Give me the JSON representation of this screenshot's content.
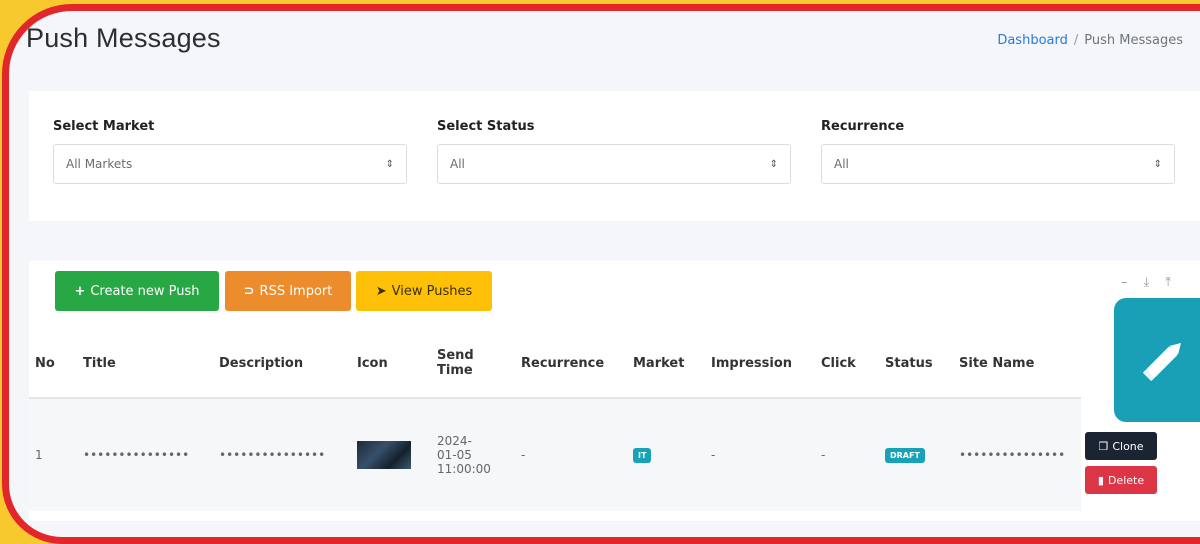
{
  "header": {
    "title": "Push Messages",
    "breadcrumb": {
      "home": "Dashboard",
      "separator": "/",
      "current": "Push Messages"
    }
  },
  "filters": [
    {
      "label": "Select Market",
      "value": "All Markets"
    },
    {
      "label": "Select Status",
      "value": "All"
    },
    {
      "label": "Recurrence",
      "value": "All"
    }
  ],
  "toolbar": {
    "create_label": "Create new Push",
    "rss_label": "RSS Import",
    "view_label": "View Pushes"
  },
  "table": {
    "columns": [
      "No",
      "Title",
      "Description",
      "Icon",
      "Send Time",
      "Recurrence",
      "Market",
      "Impression",
      "Click",
      "Status",
      "Site Name"
    ],
    "rows": [
      {
        "no": "1",
        "title": "•••••••••••••••",
        "description": "•••••••••••••••",
        "send_time_date": "2024-",
        "send_time_date2": "01-05",
        "send_time_time": "11:00:00",
        "recurrence": "-",
        "market": "IT",
        "impression": "-",
        "click": "-",
        "status": "DRAFT",
        "site_name": "•••••••••••••••",
        "clone_label": "Clone",
        "delete_label": "Delete"
      }
    ]
  },
  "colors": {
    "accent": "#17a2b8",
    "create": "#28a745",
    "rss": "#ec8c2c",
    "view": "#ffc107",
    "delete": "#dc3545",
    "clone": "#1b2433",
    "highlight_border": "#e3262a",
    "background": "#f7c92f"
  },
  "icons": {
    "create": "plus-icon",
    "rss": "rss-icon",
    "view": "paper-plane-icon",
    "clone": "copy-icon",
    "delete": "trash-icon",
    "edit": "pencil-icon"
  }
}
